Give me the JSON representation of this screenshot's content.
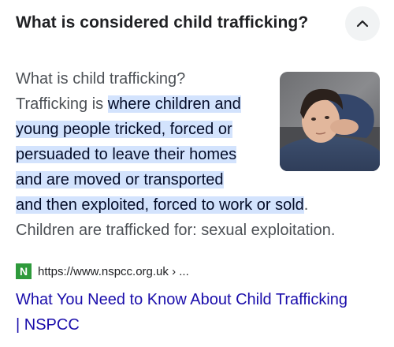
{
  "question": {
    "text": "What is considered child trafficking?",
    "toggle_icon": "chevron-up-icon"
  },
  "answer": {
    "heading": "What is child trafficking?",
    "intro": "Trafficking is ",
    "highlight_lines": [
      "where children and",
      "young people tricked, forced or",
      "persuaded to leave their homes",
      "and are moved or transported",
      "and then exploited, forced to work or sold"
    ],
    "after_highlight": ".",
    "tail": "Children are trafficked for: sexual exploitation.",
    "highlight_color": "#d3e3fd",
    "image_alt": "boy-resting-head-photo"
  },
  "source": {
    "favicon_letter": "N",
    "favicon_color": "#2e9a3b",
    "url": "https://www.nspcc.org.uk › ...",
    "title_line1": "What You Need to Know About Child Trafficking",
    "title_line2": "| NSPCC",
    "link_color": "#1a0dab"
  }
}
